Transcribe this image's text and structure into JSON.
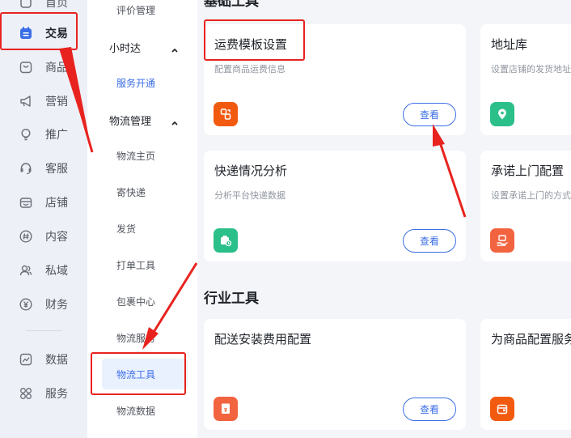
{
  "primary_nav": {
    "items": [
      {
        "label": "首页",
        "icon": "home-icon"
      },
      {
        "label": "交易",
        "icon": "calendar-icon",
        "active": true
      },
      {
        "label": "商品",
        "icon": "shop-bag-icon"
      },
      {
        "label": "营销",
        "icon": "megaphone-icon"
      },
      {
        "label": "推广",
        "icon": "lightbulb-icon"
      },
      {
        "label": "客服",
        "icon": "headset-icon"
      },
      {
        "label": "店铺",
        "icon": "store-icon"
      },
      {
        "label": "内容",
        "icon": "hashtag-icon"
      },
      {
        "label": "私域",
        "icon": "users-icon"
      },
      {
        "label": "财务",
        "icon": "yuan-icon"
      },
      {
        "label": "数据",
        "icon": "chart-icon"
      },
      {
        "label": "服务",
        "icon": "grid-icon"
      }
    ]
  },
  "secondary_nav": {
    "items": [
      {
        "label": "评价管理"
      },
      {
        "label": "小时达",
        "group": true
      },
      {
        "label": "服务开通",
        "link": true
      },
      {
        "label": "物流管理",
        "group": true
      },
      {
        "label": "物流主页"
      },
      {
        "label": "寄快递"
      },
      {
        "label": "发货"
      },
      {
        "label": "打单工具"
      },
      {
        "label": "包裹中心"
      },
      {
        "label": "物流服务"
      },
      {
        "label": "物流工具",
        "selected": true
      },
      {
        "label": "物流数据"
      }
    ]
  },
  "main": {
    "sections": [
      {
        "title": "基础工具"
      },
      {
        "title": "行业工具"
      }
    ],
    "cards": [
      {
        "title": "运费模板设置",
        "desc": "配置商品运费信息",
        "button": "查看",
        "icon_color": "#f25a10",
        "icon": "freight-template-icon"
      },
      {
        "title": "地址库",
        "desc": "设置店铺的发货地址",
        "icon_color": "#2bbf8a",
        "icon": "location-pin-icon"
      },
      {
        "title": "快递情况分析",
        "desc": "分析平台快递数据",
        "button": "查看",
        "icon_color": "#2bbf8a",
        "icon": "express-analysis-icon"
      },
      {
        "title": "承诺上门配置",
        "desc": "设置承诺上门的方式",
        "icon_color": "#f26440",
        "icon": "doorstep-icon"
      },
      {
        "title": "配送安装费用配置",
        "desc": "",
        "button": "查看",
        "icon_color": "#f26440",
        "icon": "install-fee-icon"
      },
      {
        "title": "为商品配置服务",
        "desc": "",
        "icon_color": "#f25a10",
        "icon": "service-config-icon"
      }
    ]
  },
  "colors": {
    "accent": "#3b6ee6",
    "annotation": "#e8231f",
    "nav_bg": "#eef0f7",
    "active_icon": "#3b6ee6"
  }
}
